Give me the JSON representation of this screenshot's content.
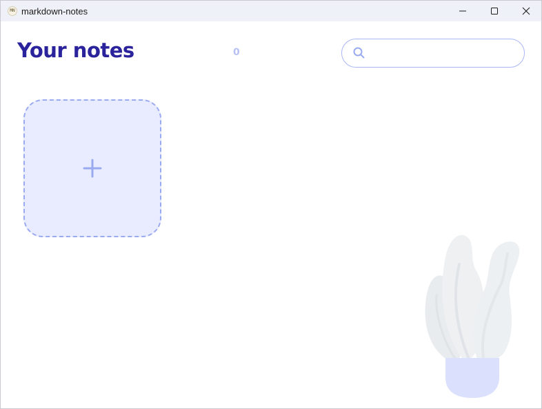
{
  "window": {
    "title": "markdown-notes",
    "app_icon_text": "MN"
  },
  "header": {
    "title": "Your notes",
    "note_count": "0"
  },
  "search": {
    "value": "",
    "placeholder": ""
  },
  "colors": {
    "title": "#2b239c",
    "accent": "#9aaaf0",
    "card_background": "#e8ecfe",
    "count": "#b7c1f4",
    "plant_pot": "#dbe0fc",
    "plant_leaves": "#eef0f2"
  },
  "icons": {
    "search": "search-icon",
    "add": "plus-icon",
    "minimize": "minimize-icon",
    "maximize": "maximize-icon",
    "close": "close-icon",
    "decoration": "plant-illustration"
  }
}
